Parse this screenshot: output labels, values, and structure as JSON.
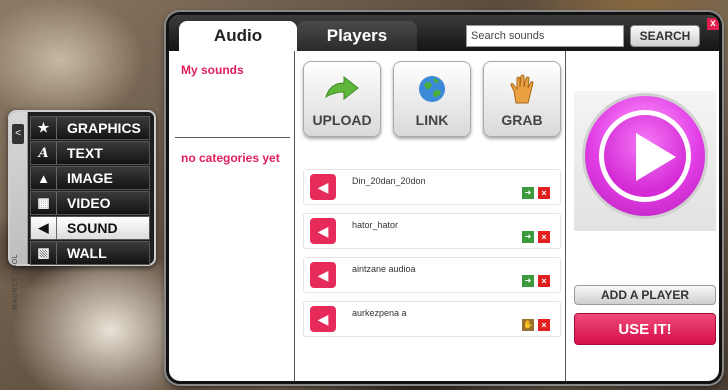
{
  "magnet_tool": {
    "collapse_glyph": "<",
    "label": "MAGNET TOOL",
    "items": [
      {
        "label": "GRAPHICS",
        "icon": "star-icon",
        "glyph": "★"
      },
      {
        "label": "TEXT",
        "icon": "text-a-icon",
        "glyph": "A"
      },
      {
        "label": "IMAGE",
        "icon": "image-icon",
        "glyph": "▲"
      },
      {
        "label": "VIDEO",
        "icon": "film-icon",
        "glyph": "▦"
      },
      {
        "label": "SOUND",
        "icon": "speaker-icon",
        "glyph": "◀"
      },
      {
        "label": "WALL",
        "icon": "wall-icon",
        "glyph": "▧"
      }
    ],
    "active": "SOUND"
  },
  "tabs": {
    "audio": "Audio",
    "players": "Players"
  },
  "search": {
    "value": "Search sounds",
    "button": "SEARCH"
  },
  "close_glyph": "x",
  "categories": {
    "my_sounds": "My sounds",
    "empty": "no categories yet"
  },
  "actions": {
    "upload": "UPLOAD",
    "link": "LINK",
    "grab": "GRAB"
  },
  "sounds": [
    {
      "name": "Din_20dan_20don",
      "action_icon": "forward-icon"
    },
    {
      "name": "hator_hator",
      "action_icon": "forward-icon"
    },
    {
      "name": "aintzane audioa",
      "action_icon": "forward-icon"
    },
    {
      "name": "aurkezpena a",
      "action_icon": "hand-icon"
    }
  ],
  "player": {
    "add_player": "ADD A PLAYER",
    "use_it": "USE IT!"
  },
  "colors": {
    "accent": "#e0205a",
    "play": "#e23de6"
  }
}
